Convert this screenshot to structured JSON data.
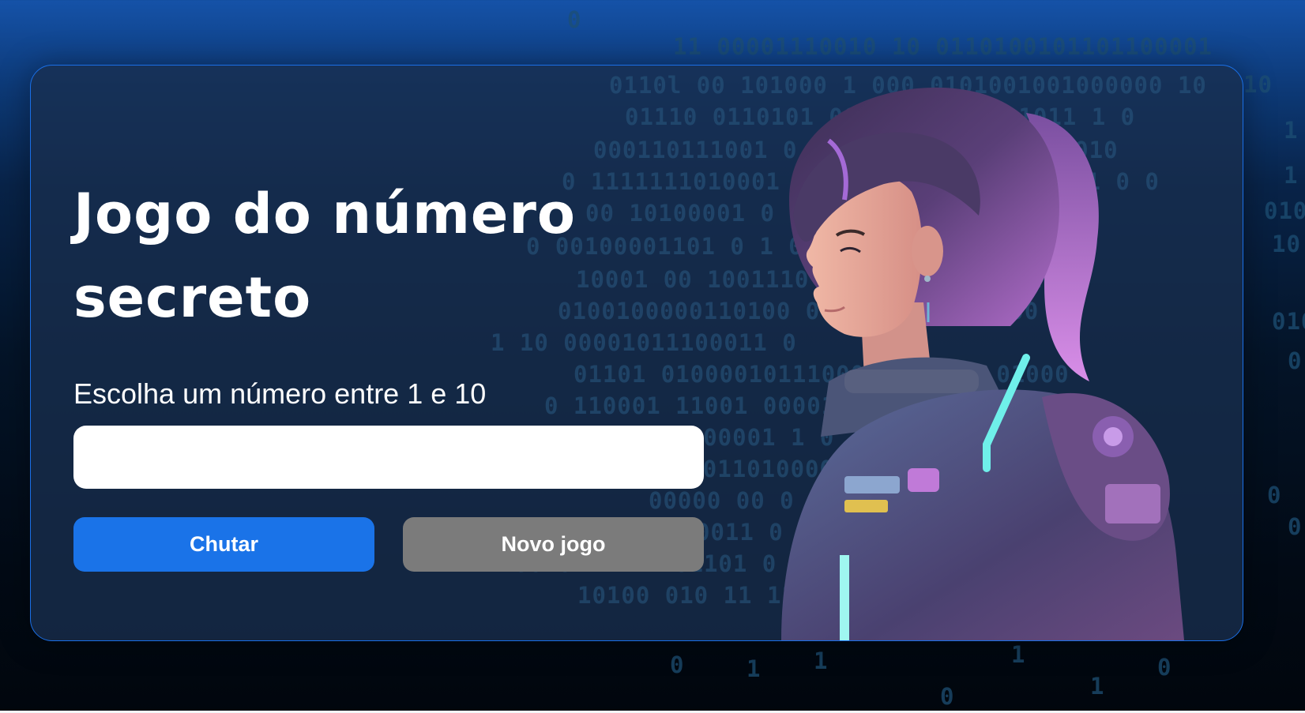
{
  "page": {
    "title": "Jogo do número secreto",
    "instruction": "Escolha um número entre 1 e 10"
  },
  "input": {
    "value": "",
    "placeholder": ""
  },
  "buttons": {
    "guess_label": "Chutar",
    "new_game_label": "Novo jogo"
  },
  "colors": {
    "background_top": "#1552a8",
    "background_bottom": "#01060d",
    "card_border": "#1a6fe6",
    "primary_button": "#1a73e8",
    "secondary_button": "#7b7b7b",
    "text": "#ffffff"
  },
  "icons": {
    "illustration": "cyberpunk-girl-illustration"
  }
}
